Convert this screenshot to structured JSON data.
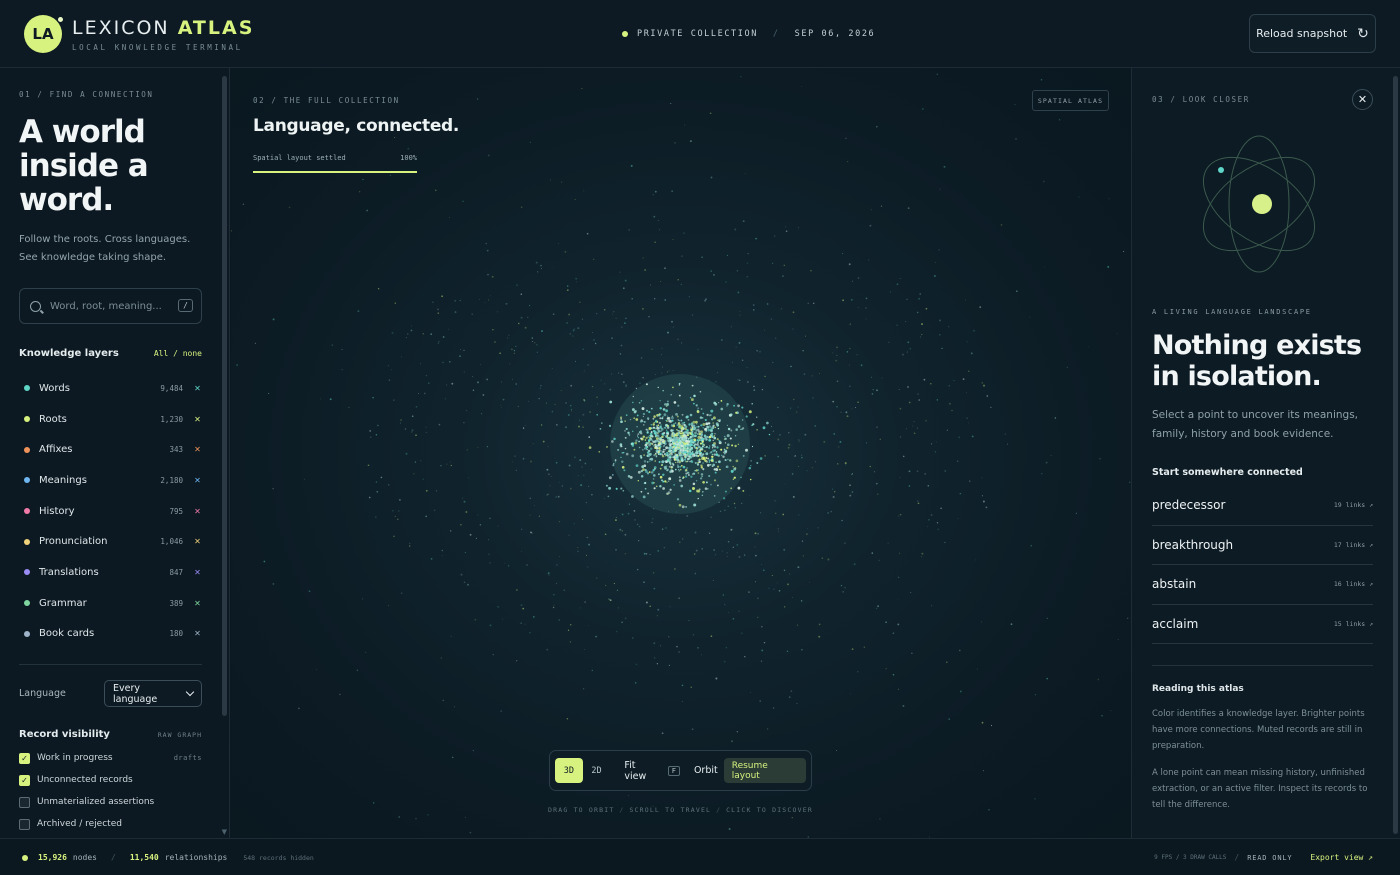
{
  "header": {
    "logo": "LA",
    "brand_main": "LEXICON",
    "brand_accent": "ATLAS",
    "subtitle": "LOCAL KNOWLEDGE TERMINAL",
    "status": "PRIVATE COLLECTION",
    "separator": "/",
    "date": "SEP 06, 2026",
    "reload_label": "Reload snapshot",
    "reload_icon": "refresh-icon"
  },
  "left": {
    "section_label": "01 / FIND A CONNECTION",
    "title_lines": [
      "A world",
      "inside a",
      "word."
    ],
    "intro_lines": [
      "Follow the roots. Cross languages.",
      "See knowledge taking shape."
    ],
    "search_placeholder": "Word, root, meaning...",
    "search_value": "",
    "search_shortcut": "/",
    "layers_title": "Knowledge layers",
    "layers_toggle": "All / none",
    "layers": [
      {
        "name": "Words",
        "count": "9,484",
        "color": "#5fd6c8"
      },
      {
        "name": "Roots",
        "count": "1,230",
        "color": "#d7f27f"
      },
      {
        "name": "Affixes",
        "count": "343",
        "color": "#f0935a"
      },
      {
        "name": "Meanings",
        "count": "2,180",
        "color": "#6fb6f0"
      },
      {
        "name": "History",
        "count": "795",
        "color": "#f07ba8"
      },
      {
        "name": "Pronunciation",
        "count": "1,046",
        "color": "#f0d27a"
      },
      {
        "name": "Translations",
        "count": "847",
        "color": "#9b8cf5"
      },
      {
        "name": "Grammar",
        "count": "389",
        "color": "#7fd6a0"
      },
      {
        "name": "Book cards",
        "count": "180",
        "color": "#9fb4c8"
      }
    ],
    "language_label": "Language",
    "language_value": "Every language",
    "visibility_title": "Record visibility",
    "visibility_tag": "RAW GRAPH",
    "visibility": [
      {
        "label": "Work in progress",
        "checked": true,
        "tag": "drafts"
      },
      {
        "label": "Unconnected records",
        "checked": true,
        "tag": ""
      },
      {
        "label": "Unmaterialized assertions",
        "checked": false,
        "tag": ""
      },
      {
        "label": "Archived / rejected",
        "checked": false,
        "tag": ""
      }
    ]
  },
  "center": {
    "section_label": "02 / THE FULL COLLECTION",
    "title": "Language, connected.",
    "progress_label": "Spatial layout settled",
    "progress_value": "100%",
    "progress_fraction": 1.0,
    "tag": "SPATIAL ATLAS",
    "toolbar": {
      "mode_3d": "3D",
      "mode_2d": "2D",
      "fit": "Fit view",
      "fit_key": "F",
      "orbit": "Orbit",
      "resume": "Resume layout"
    },
    "hints": [
      "DRAG TO ORBIT",
      "SCROLL TO TRAVEL",
      "CLICK TO DISCOVER"
    ]
  },
  "right": {
    "section_label": "03 / LOOK CLOSER",
    "close_icon": "close-icon",
    "eyebrow": "A LIVING LANGUAGE LANDSCAPE",
    "title_lines": [
      "Nothing exists",
      "in isolation."
    ],
    "desc": "Select a point to uncover its meanings, family, history and book evidence.",
    "start_title": "Start somewhere connected",
    "connections": [
      {
        "word": "predecessor",
        "links": "19 links ↗"
      },
      {
        "word": "breakthrough",
        "links": "17 links ↗"
      },
      {
        "word": "abstain",
        "links": "16 links ↗"
      },
      {
        "word": "acclaim",
        "links": "15 links ↗"
      }
    ],
    "reading_title": "Reading this atlas",
    "reading_p1": "Color identifies a knowledge layer. Brighter points have more connections. Muted records are still in preparation.",
    "reading_p2": "A lone point can mean missing history, unfinished extraction, or an active filter. Inspect its records to tell the difference."
  },
  "footer": {
    "nodes_count": "15,926",
    "nodes_label": "nodes",
    "rel_count": "11,540",
    "rel_label": "relationships",
    "hidden": "548 records hidden",
    "fps": "9 FPS / 3 DRAW CALLS",
    "mode": "READ ONLY",
    "export": "Export view ↗"
  },
  "colors": {
    "accent": "#d7f27f",
    "background": "#0b1821"
  }
}
